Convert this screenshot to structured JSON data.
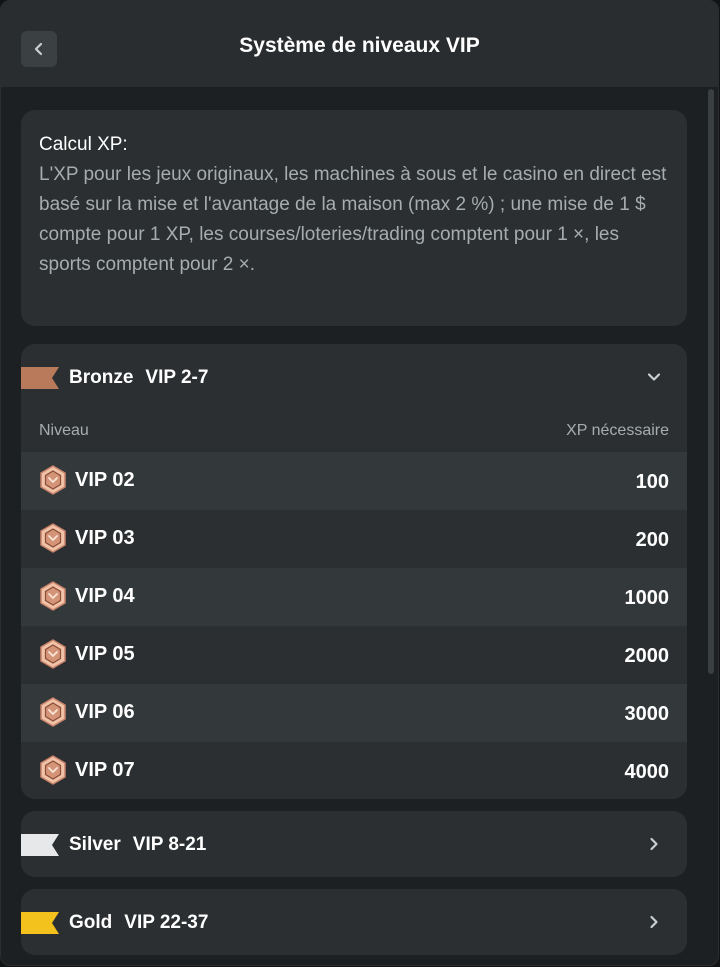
{
  "header": {
    "title": "Système de niveaux VIP"
  },
  "info": {
    "label": "Calcul XP:",
    "text": "L'XP pour les jeux originaux, les machines à sous et le casino en direct est basé sur la mise et l'avantage de la maison (max 2 %) ; une mise de 1 $ compte pour 1 XP, les courses/loteries/trading comptent pour 1 ×, les sports comptent pour 2 ×."
  },
  "tiers": [
    {
      "name": "Bronze",
      "range": "VIP 2-7",
      "color": "#b9795b",
      "expanded": true,
      "col_level": "Niveau",
      "col_xp": "XP nécessaire",
      "levels": [
        {
          "label": "VIP 02",
          "xp": "100"
        },
        {
          "label": "VIP 03",
          "xp": "200"
        },
        {
          "label": "VIP 04",
          "xp": "1000"
        },
        {
          "label": "VIP 05",
          "xp": "2000"
        },
        {
          "label": "VIP 06",
          "xp": "3000"
        },
        {
          "label": "VIP 07",
          "xp": "4000"
        }
      ]
    },
    {
      "name": "Silver",
      "range": "VIP 8-21",
      "color": "#e6e8ea",
      "expanded": false
    },
    {
      "name": "Gold",
      "range": "VIP 22-37",
      "color": "#f4c21d",
      "expanded": false
    }
  ],
  "colors": {
    "background": "#1d2022",
    "card": "#2b2f31",
    "row_alt": "#33383a",
    "muted_text": "#a7acaf"
  }
}
